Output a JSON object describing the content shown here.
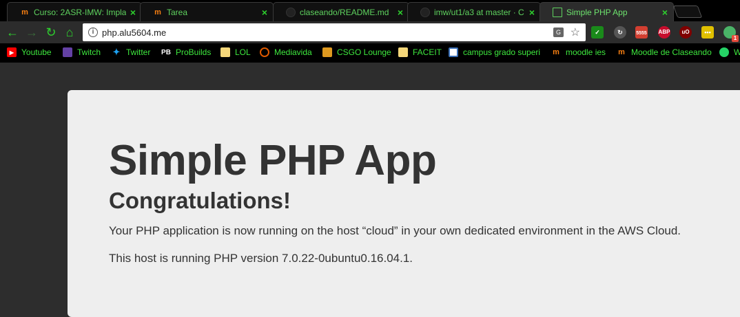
{
  "tabs": [
    {
      "title": "Curso: 2ASR-IMW: Impla",
      "favicon": "moodle-icon",
      "active": false
    },
    {
      "title": "Tarea",
      "favicon": "moodle-icon",
      "active": false
    },
    {
      "title": "claseando/README.md",
      "favicon": "github-icon",
      "active": false
    },
    {
      "title": "imw/ut1/a3 at master · C",
      "favicon": "github-icon",
      "active": false
    },
    {
      "title": "Simple PHP App",
      "favicon": "page-icon",
      "active": true
    }
  ],
  "address_bar": {
    "url": "php.alu5604.me"
  },
  "extensions": [
    {
      "name": "checkmark-extension-icon",
      "color": "#1a8a1a",
      "label": ""
    },
    {
      "name": "sync-extension-icon",
      "color": "#555555",
      "label": ""
    },
    {
      "name": "gmail-extension-icon",
      "color": "#d23f31",
      "label": "5555"
    },
    {
      "name": "adblock-plus-icon",
      "color": "#c70d2c",
      "label": "ABP"
    },
    {
      "name": "ublock-icon",
      "color": "#800000",
      "label": "uO"
    },
    {
      "name": "notes-extension-icon",
      "color": "#e0c000",
      "label": ""
    },
    {
      "name": "pushbullet-icon",
      "color": "#4ab367",
      "label": "1"
    }
  ],
  "bookmarks": [
    {
      "label": "Youtube",
      "icon": "youtube-icon",
      "color": "#ff0000"
    },
    {
      "label": "Twitch",
      "icon": "twitch-icon",
      "color": "#6441a5"
    },
    {
      "label": "Twitter",
      "icon": "twitter-icon",
      "color": "#1da1f2"
    },
    {
      "label": "ProBuilds",
      "icon": "probuilds-icon",
      "color": "#ffffff"
    },
    {
      "label": "LOL",
      "icon": "folder-icon",
      "color": "#f5d77a"
    },
    {
      "label": "Mediavida",
      "icon": "mediavida-icon",
      "color": "#e05a00"
    },
    {
      "label": "CSGO Lounge",
      "icon": "csgo-lounge-icon",
      "color": "#e09a20"
    },
    {
      "label": "FACEIT",
      "icon": "folder-icon",
      "color": "#f5d77a"
    },
    {
      "label": "campus grado superi",
      "icon": "campus-icon",
      "color": "#3b6fb6"
    },
    {
      "label": "moodle ies",
      "icon": "moodle-icon",
      "color": "#f98012"
    },
    {
      "label": "Moodle de Claseando",
      "icon": "moodle-icon",
      "color": "#f98012"
    },
    {
      "label": "W",
      "icon": "whatsapp-icon",
      "color": "#25d366"
    }
  ],
  "content": {
    "title": "Simple PHP App",
    "subtitle": "Congratulations!",
    "paragraph1": "Your PHP application is now running on the host “cloud” in your own dedicated environment in the AWS Cloud.",
    "paragraph2": "This host is running PHP version 7.0.22-0ubuntu0.16.04.1."
  },
  "colors": {
    "tab_text": "#5fd35f",
    "bookmark_text": "#3ee83e",
    "page_background": "#2d2d2d",
    "jumbotron_background": "#eeeeee",
    "content_text": "#333333"
  }
}
